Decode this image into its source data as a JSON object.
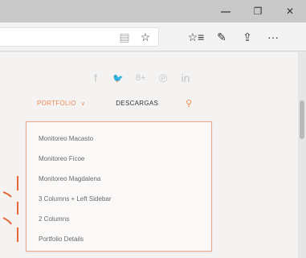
{
  "window": {
    "controls": [
      {
        "name": "minimize-button",
        "glyph": "—"
      },
      {
        "name": "maximize-button",
        "glyph": "❐"
      },
      {
        "name": "close-button",
        "glyph": "✕"
      }
    ]
  },
  "toolbar": {
    "icons": [
      {
        "name": "reading-view-icon",
        "glyph": "▤"
      },
      {
        "name": "favorite-star-icon",
        "glyph": "☆"
      },
      {
        "name": "favorites-list-icon",
        "glyph": "☆≡"
      },
      {
        "name": "pen-icon",
        "glyph": "✎"
      },
      {
        "name": "share-icon",
        "glyph": "⇪"
      },
      {
        "name": "more-icon",
        "glyph": "···"
      }
    ]
  },
  "social": [
    {
      "name": "facebook-icon",
      "glyph": "f"
    },
    {
      "name": "twitter-icon",
      "glyph": "🐦"
    },
    {
      "name": "googleplus-icon",
      "glyph": "8+"
    },
    {
      "name": "pinterest-icon",
      "glyph": "℗"
    },
    {
      "name": "linkedin-icon",
      "glyph": "in"
    }
  ],
  "nav": {
    "portfolio": "PORTFOLIO",
    "portfolio_caret": "∨",
    "descargas": "DESCARGAS",
    "search_icon": "⚲"
  },
  "dropdown": {
    "items": [
      "Monitoreo Macasto",
      "Monitoreo Ficoe",
      "Monitoreo Magdalena",
      "3 Columns + Left Sidebar",
      "2 Columns",
      "Portfolio Details"
    ]
  },
  "colors": {
    "accent": "#ef8a52",
    "dropdown_border": "#f0a68c"
  }
}
